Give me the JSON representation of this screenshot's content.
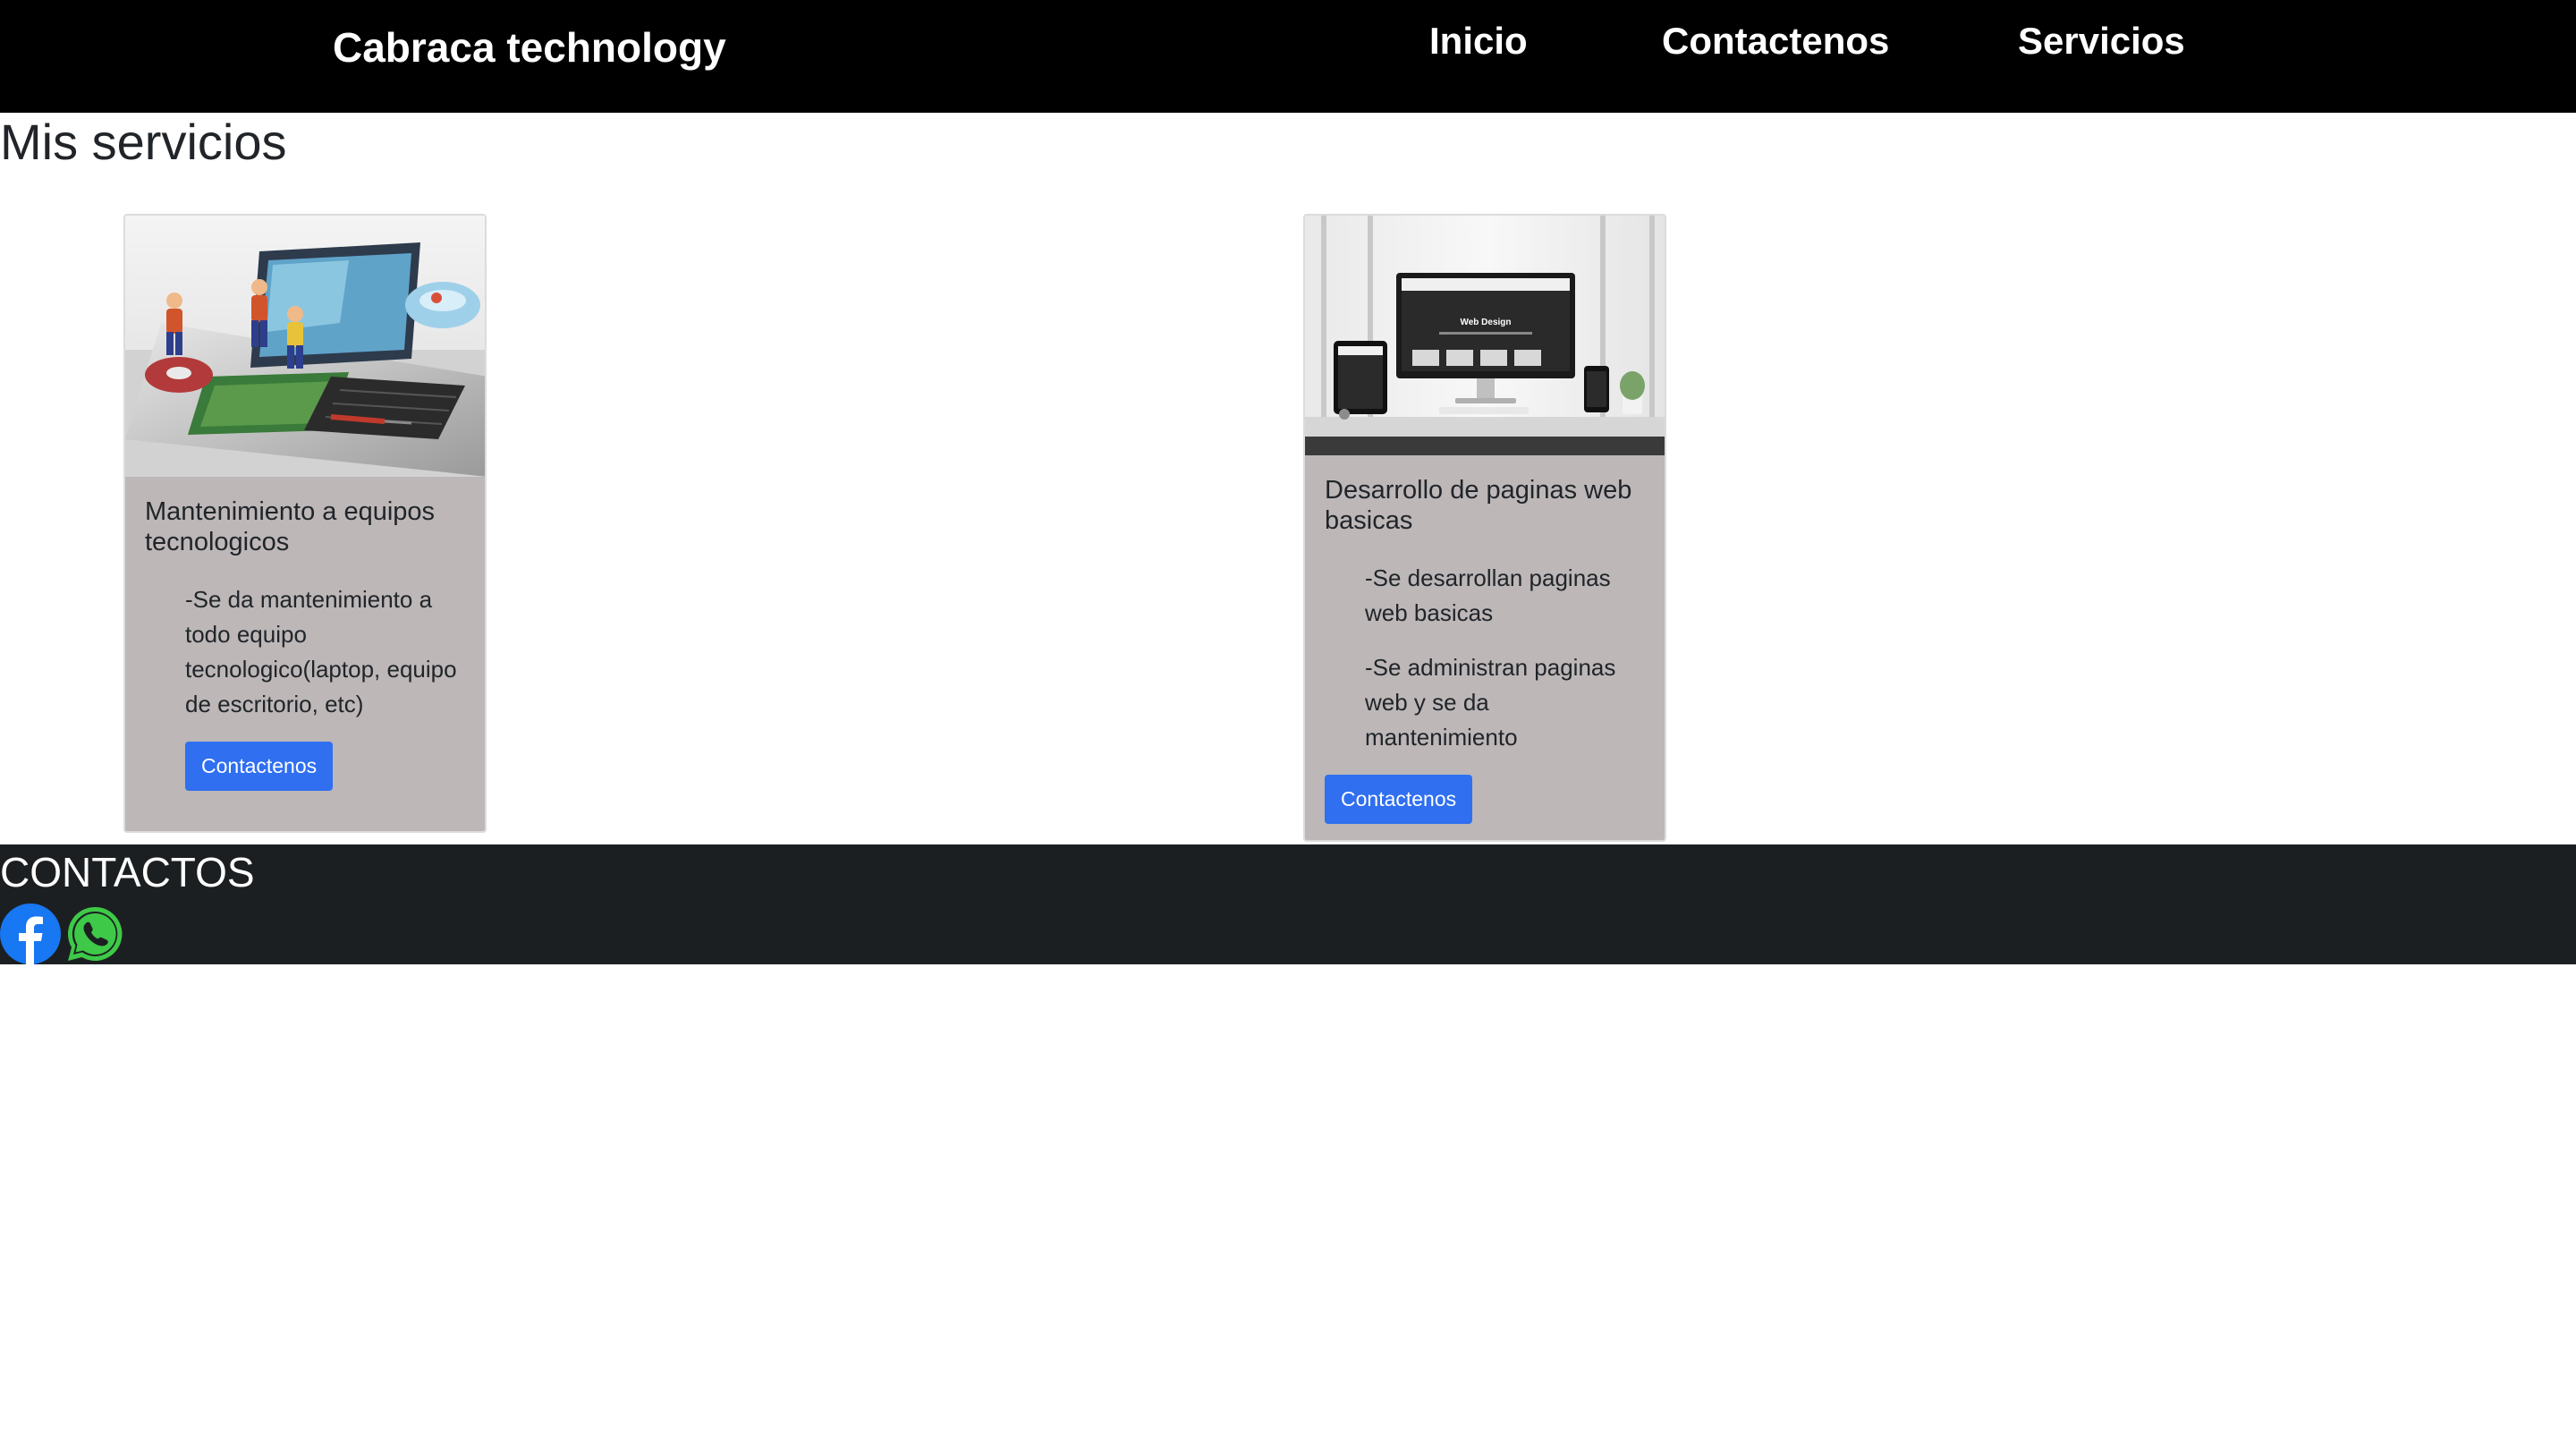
{
  "navbar": {
    "brand": "Cabraca technology",
    "links": [
      {
        "label": "Inicio"
      },
      {
        "label": "Contactenos"
      },
      {
        "label": "Servicios"
      }
    ]
  },
  "section": {
    "title": "Mis servicios"
  },
  "cards": [
    {
      "image": "laptop-repair-illustration",
      "title": "Mantenimiento a equipos tecnologicos",
      "texts": [
        "-Se da mantenimiento a todo equipo tecnologico(laptop, equipo de escritorio, etc)"
      ],
      "button": "Contactenos"
    },
    {
      "image": "web-design-devices-photo",
      "title": "Desarrollo de paginas web basicas",
      "texts": [
        "-Se desarrollan paginas web basicas",
        "-Se administran paginas web y se da mantenimiento"
      ],
      "button": "Contactenos"
    }
  ],
  "footer": {
    "title": "CONTACTOS",
    "icons": [
      "facebook-icon",
      "whatsapp-icon"
    ]
  },
  "colors": {
    "navbar_bg": "#000000",
    "card_body_bg": "#bdb7b8",
    "button_bg": "#2f6ff0",
    "footer_bg": "#1c1f21",
    "facebook": "#1877f2",
    "whatsapp": "#3ec948"
  }
}
